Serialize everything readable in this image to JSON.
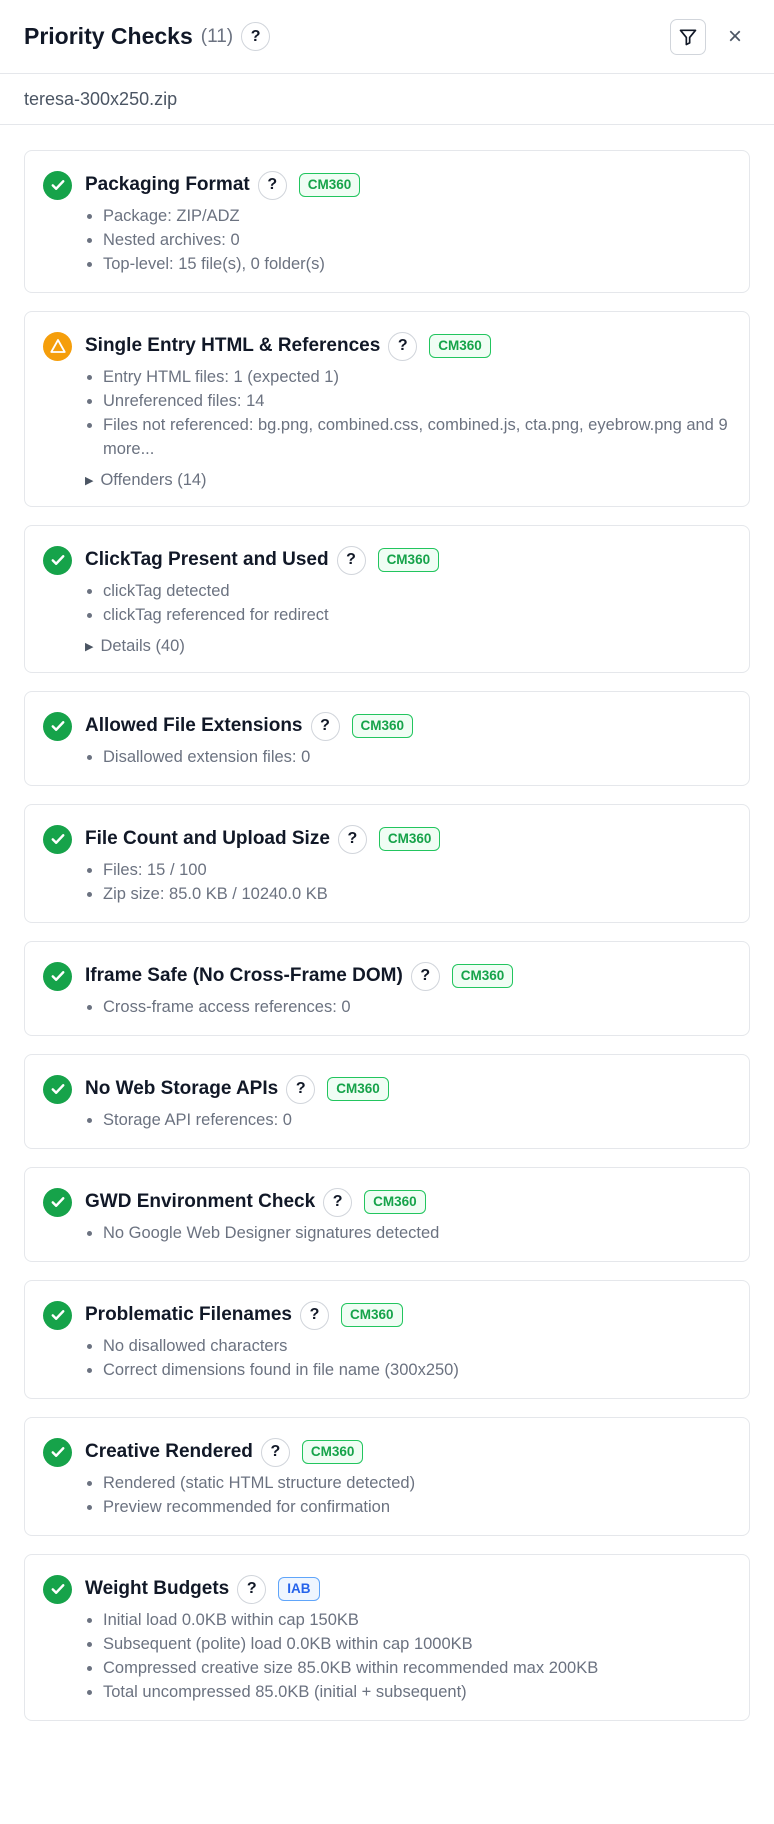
{
  "header": {
    "title": "Priority Checks",
    "count": "(11)",
    "help": "?",
    "close": "×"
  },
  "filename": "teresa-300x250.zip",
  "checks": [
    {
      "title": "Packaging Format",
      "status": "pass",
      "badge": "CM360",
      "badge_color": "green",
      "lines": [
        "Package: ZIP/ADZ",
        "Nested archives: 0",
        "Top-level: 15 file(s), 0 folder(s)"
      ]
    },
    {
      "title": "Single Entry HTML & References",
      "status": "warn",
      "badge": "CM360",
      "badge_color": "green",
      "lines": [
        "Entry HTML files: 1 (expected 1)",
        "Unreferenced files: 14",
        "Files not referenced: bg.png, combined.css, combined.js, cta.png, eyebrow.png and 9 more..."
      ],
      "expander": "Offenders (14)"
    },
    {
      "title": "ClickTag Present and Used",
      "status": "pass",
      "badge": "CM360",
      "badge_color": "green",
      "lines": [
        "clickTag detected",
        "clickTag referenced for redirect"
      ],
      "expander": "Details (40)"
    },
    {
      "title": "Allowed File Extensions",
      "status": "pass",
      "badge": "CM360",
      "badge_color": "green",
      "lines": [
        "Disallowed extension files: 0"
      ]
    },
    {
      "title": "File Count and Upload Size",
      "status": "pass",
      "badge": "CM360",
      "badge_color": "green",
      "lines": [
        "Files: 15 / 100",
        "Zip size: 85.0 KB / 10240.0 KB"
      ]
    },
    {
      "title": "Iframe Safe (No Cross-Frame DOM)",
      "status": "pass",
      "badge": "CM360",
      "badge_color": "green",
      "lines": [
        "Cross-frame access references: 0"
      ]
    },
    {
      "title": "No Web Storage APIs",
      "status": "pass",
      "badge": "CM360",
      "badge_color": "green",
      "lines": [
        "Storage API references: 0"
      ]
    },
    {
      "title": "GWD Environment Check",
      "status": "pass",
      "badge": "CM360",
      "badge_color": "green",
      "lines": [
        "No Google Web Designer signatures detected"
      ]
    },
    {
      "title": "Problematic Filenames",
      "status": "pass",
      "badge": "CM360",
      "badge_color": "green",
      "lines": [
        "No disallowed characters",
        "Correct dimensions found in file name (300x250)"
      ]
    },
    {
      "title": "Creative Rendered",
      "status": "pass",
      "badge": "CM360",
      "badge_color": "green",
      "lines": [
        "Rendered (static HTML structure detected)",
        "Preview recommended for confirmation"
      ]
    },
    {
      "title": "Weight Budgets",
      "status": "pass",
      "badge": "IAB",
      "badge_color": "blue",
      "lines": [
        "Initial load 0.0KB within cap 150KB",
        "Subsequent (polite) load 0.0KB within cap 1000KB",
        "Compressed creative size 85.0KB within recommended max 200KB",
        "Total uncompressed 85.0KB (initial + subsequent)"
      ]
    }
  ]
}
